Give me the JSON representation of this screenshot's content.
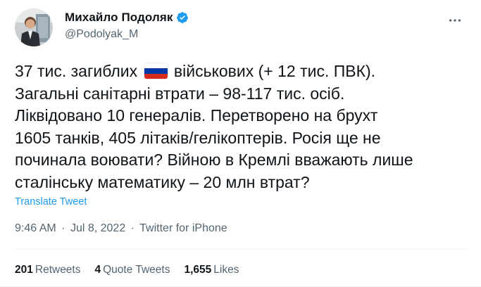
{
  "author": {
    "display_name": "Михайло Подоляк",
    "handle": "@Podolyak_M",
    "verified_icon": "verified-badge-icon",
    "avatar_icon": "avatar"
  },
  "tweet": {
    "lines": [
      {
        "before": "37 тис. загиблих ",
        "flag": "russian-flag-icon",
        "after": " військових (+ 12 тис. ПВК)."
      },
      {
        "text": "Загальні санітарні втрати – 98-117 тис. осіб."
      },
      {
        "text": "Ліквідовано 10 генералів. Перетворено на брухт"
      },
      {
        "text": "1605 танків, 405 літаків/гелікоптерів. Росія ще не"
      },
      {
        "text": "починала воювати? Війною в Кремлі вважають лише"
      },
      {
        "text": "сталінську математику – 20 млн втрат?"
      }
    ],
    "translate_label": "Translate Tweet"
  },
  "meta": {
    "time": "9:46 AM",
    "separator": "·",
    "date": "Jul 8, 2022",
    "source": "Twitter for iPhone"
  },
  "stats": {
    "retweets": {
      "count": "201",
      "label": "Retweets"
    },
    "quotes": {
      "count": "4",
      "label": "Quote Tweets"
    },
    "likes": {
      "count": "1,655",
      "label": "Likes"
    }
  },
  "colors": {
    "text": "#0f1419",
    "secondary": "#536471",
    "accent": "#1d9bf0",
    "divider": "#eff3f4",
    "flag_white": "#ffffff",
    "flag_blue": "#0039a6",
    "flag_red": "#d52b1e"
  },
  "icons": {
    "more": "more-options-icon"
  }
}
